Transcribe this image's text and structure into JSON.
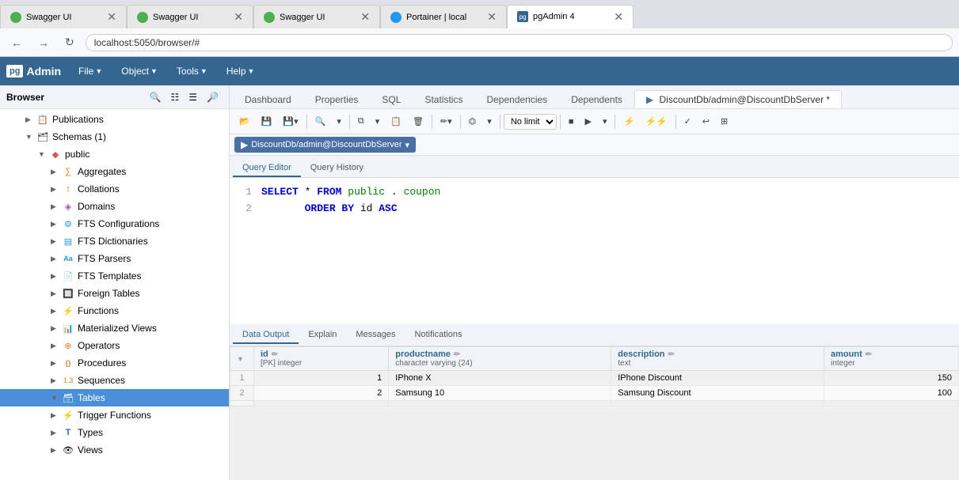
{
  "browser_tabs": [
    {
      "title": "Swagger UI",
      "favicon": "green",
      "active": false
    },
    {
      "title": "Swagger UI",
      "favicon": "green",
      "active": false
    },
    {
      "title": "Swagger UI",
      "favicon": "green",
      "active": false
    },
    {
      "title": "Portainer | local",
      "favicon": "blue",
      "active": false
    },
    {
      "title": "pgAdmin 4",
      "favicon": "pgadmin",
      "active": true
    }
  ],
  "address_bar": {
    "url": "localhost:5050/browser/#"
  },
  "menu": {
    "logo_box": "pg",
    "logo_text": "Admin",
    "items": [
      "File",
      "Object",
      "Tools",
      "Help"
    ]
  },
  "browser": {
    "title": "Browser",
    "tree": [
      {
        "label": "Publications",
        "indent": "indent2",
        "icon": "📋",
        "arrow": "▶",
        "expanded": false
      },
      {
        "label": "Schemas (1)",
        "indent": "indent2",
        "icon": "🗂",
        "arrow": "▼",
        "expanded": true
      },
      {
        "label": "public",
        "indent": "indent3",
        "icon": "🔷",
        "arrow": "▼",
        "expanded": true
      },
      {
        "label": "Aggregates",
        "indent": "indent4",
        "icon": "∑",
        "arrow": "▶"
      },
      {
        "label": "Collations",
        "indent": "indent4",
        "icon": "↕",
        "arrow": "▶"
      },
      {
        "label": "Domains",
        "indent": "indent4",
        "icon": "◈",
        "arrow": "▶"
      },
      {
        "label": "FTS Configurations",
        "indent": "indent4",
        "icon": "⚙",
        "arrow": "▶"
      },
      {
        "label": "FTS Dictionaries",
        "indent": "indent4",
        "icon": "📖",
        "arrow": "▶"
      },
      {
        "label": "FTS Parsers",
        "indent": "indent4",
        "icon": "Aa",
        "arrow": "▶"
      },
      {
        "label": "FTS Templates",
        "indent": "indent4",
        "icon": "📄",
        "arrow": "▶"
      },
      {
        "label": "Foreign Tables",
        "indent": "indent4",
        "icon": "🔲",
        "arrow": "▶"
      },
      {
        "label": "Functions",
        "indent": "indent4",
        "icon": "⚡",
        "arrow": "▶"
      },
      {
        "label": "Materialized Views",
        "indent": "indent4",
        "icon": "📊",
        "arrow": "▶"
      },
      {
        "label": "Operators",
        "indent": "indent4",
        "icon": "⊕",
        "arrow": "▶"
      },
      {
        "label": "Procedures",
        "indent": "indent4",
        "icon": "{}",
        "arrow": "▶"
      },
      {
        "label": "Sequences",
        "indent": "indent4",
        "icon": "1.3",
        "arrow": "▶"
      },
      {
        "label": "Tables",
        "indent": "indent4",
        "icon": "🗃",
        "arrow": "▼",
        "expanded": true,
        "selected": true,
        "highlighted": true
      },
      {
        "label": "Trigger Functions",
        "indent": "indent4",
        "icon": "⚡",
        "arrow": "▶"
      },
      {
        "label": "Types",
        "indent": "indent4",
        "icon": "T",
        "arrow": "▶"
      },
      {
        "label": "Views",
        "indent": "indent4",
        "icon": "👁",
        "arrow": "▶"
      }
    ]
  },
  "panel_tabs": [
    "Dashboard",
    "Properties",
    "SQL",
    "Statistics",
    "Dependencies",
    "Dependents",
    "DiscountDb/admin@DiscountDbServer *"
  ],
  "active_panel_tab": "DiscountDb/admin@DiscountDbServer *",
  "query_toolbar": {
    "db_label": "DiscountDb/admin@DiscountDbServer"
  },
  "query_editor_tabs": [
    "Query Editor",
    "Query History"
  ],
  "active_query_tab": "Query Editor",
  "query_lines": [
    {
      "num": "1",
      "content": "SELECT * FROM public.coupon"
    },
    {
      "num": "2",
      "content": "       ORDER BY id ASC"
    }
  ],
  "results_tabs": [
    "Data Output",
    "Explain",
    "Messages",
    "Notifications"
  ],
  "active_results_tab": "Data Output",
  "results_columns": [
    {
      "name": "id",
      "type": "[PK] integer",
      "sortable": true
    },
    {
      "name": "productname",
      "type": "character varying (24)"
    },
    {
      "name": "description",
      "type": "text"
    },
    {
      "name": "amount",
      "type": "integer"
    }
  ],
  "results_rows": [
    {
      "row": "1",
      "id": "1",
      "productname": "IPhone X",
      "description": "IPhone Discount",
      "amount": "150"
    },
    {
      "row": "2",
      "id": "2",
      "productname": "Samsung 10",
      "description": "Samsung Discount",
      "amount": "100"
    }
  ],
  "no_limit": "No limit",
  "toolbar_icons": {
    "refresh": "↺",
    "save": "💾",
    "open": "📂",
    "search": "🔍",
    "copy": "⧉",
    "paste": "📋",
    "delete": "🗑",
    "edit": "✏",
    "filter": "⏣",
    "play": "▶",
    "stop": "■",
    "explain": "⚡"
  }
}
